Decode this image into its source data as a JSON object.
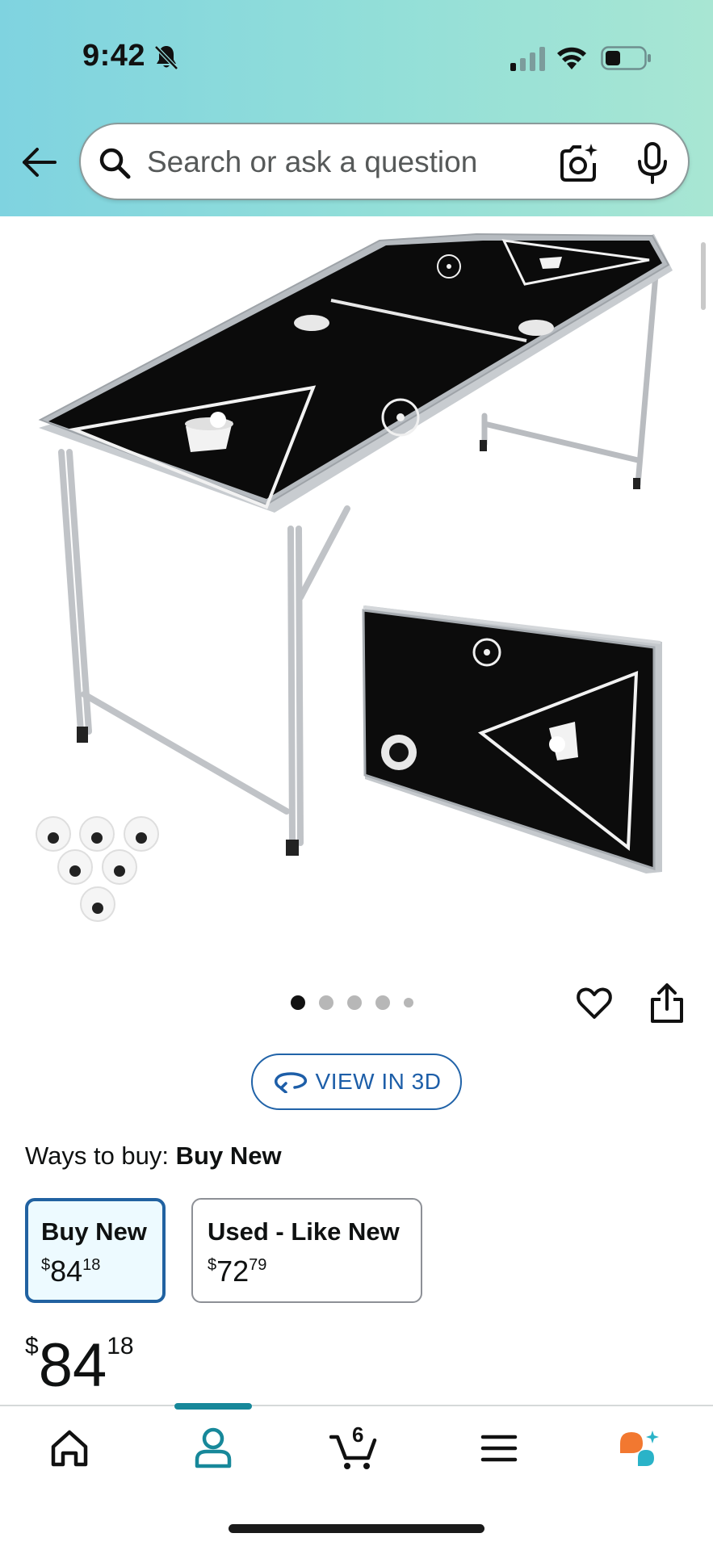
{
  "status_bar": {
    "time": "9:42"
  },
  "search": {
    "placeholder": "Search or ask a question"
  },
  "product_gallery": {
    "image_description_icon": "beer-pong-table-product-image",
    "total_images": 5,
    "active_index": 0,
    "actions": [
      "heart-icon",
      "share-icon"
    ]
  },
  "view_3d": {
    "label": "VIEW IN 3D"
  },
  "ways_to_buy": {
    "label": "Ways to buy:",
    "value": "Buy New",
    "options": [
      {
        "name": "Buy New",
        "price_currency": "$",
        "price_whole": "84",
        "price_fraction": "18",
        "selected": true
      },
      {
        "name": "Used - Like New",
        "price_currency": "$",
        "price_whole": "72",
        "price_fraction": "79",
        "selected": false
      }
    ]
  },
  "price": {
    "currency": "$",
    "whole": "84",
    "fraction": "18"
  },
  "bottom_nav": {
    "items": [
      "home-icon",
      "account-icon",
      "cart-icon",
      "menu-icon",
      "rufus-icon"
    ],
    "active": "account-icon",
    "cart_count": "6"
  },
  "colors": {
    "header_gradient_start": "#7fd3e0",
    "header_gradient_end": "#a8e6d3",
    "selected_border": "#2162a1",
    "selected_background": "#edfaff",
    "link_blue": "#1d5ea8",
    "nav_active": "#17889a",
    "rufus_orange": "#f27830",
    "rufus_teal": "#2ab3c8"
  }
}
